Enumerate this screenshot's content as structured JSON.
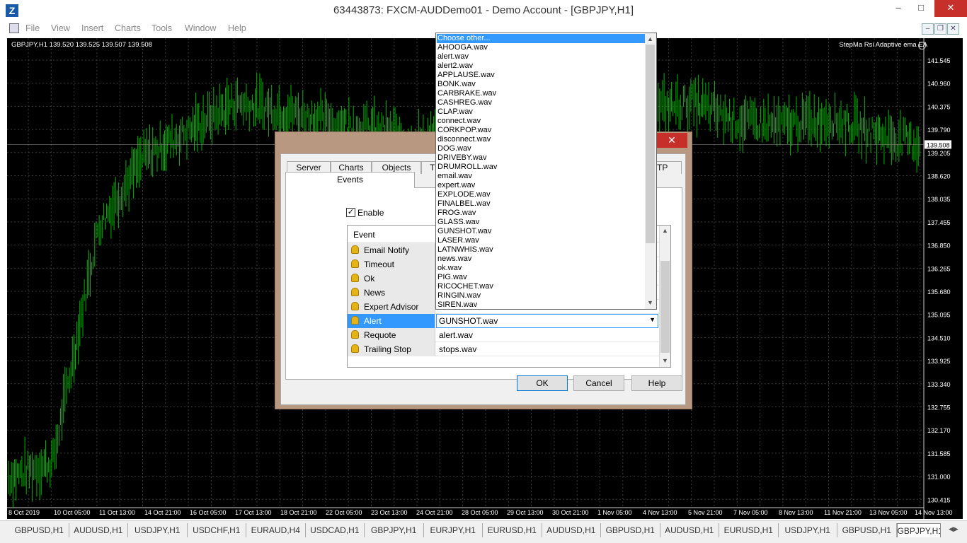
{
  "window": {
    "title": "63443873: FXCM-AUDDemo01 - Demo Account - [GBPJPY,H1]",
    "icon_label": "Z",
    "minimize": "–",
    "maximize": "□",
    "close": "✕"
  },
  "menu": {
    "items": [
      "File",
      "View",
      "Insert",
      "Charts",
      "Tools",
      "Window",
      "Help"
    ],
    "mdi_minimize": "–",
    "mdi_restore": "❐",
    "mdi_close": "✕"
  },
  "chart": {
    "symbol_info": "GBPJPY,H1  139.520 139.525 139.507 139.508",
    "ea_label": "StepMa Rsi Adaptive ema EA",
    "current_price": "139.508",
    "current_price_value": 139.508,
    "price_ticks": [
      "141.545",
      "140.960",
      "140.375",
      "139.790",
      "139.205",
      "138.620",
      "138.035",
      "137.455",
      "136.850",
      "136.265",
      "135.680",
      "135.095",
      "134.510",
      "133.925",
      "133.340",
      "132.755",
      "132.170",
      "131.585",
      "131.000",
      "130.415"
    ],
    "time_ticks": [
      "8 Oct 2019",
      "10 Oct 05:00",
      "11 Oct 13:00",
      "14 Oct 21:00",
      "16 Oct 05:00",
      "17 Oct 13:00",
      "18 Oct 21:00",
      "22 Oct 05:00",
      "23 Oct 13:00",
      "24 Oct 21:00",
      "28 Oct 05:00",
      "29 Oct 13:00",
      "30 Oct 21:00",
      "1 Nov 05:00",
      "4 Nov 13:00",
      "5 Nov 21:00",
      "7 Nov 05:00",
      "8 Nov 13:00",
      "11 Nov 21:00",
      "13 Nov 05:00",
      "14 Nov 13:00"
    ],
    "colors": {
      "background": "#000000",
      "grid": "#3c3c3c",
      "bars": "#00b400",
      "axis_text": "#ffffff"
    }
  },
  "chart_data": {
    "type": "line",
    "title": "GBPJPY,H1",
    "x": [
      "8 Oct 2019",
      "10 Oct 05:00",
      "11 Oct 13:00",
      "14 Oct 21:00",
      "16 Oct 05:00",
      "17 Oct 13:00",
      "18 Oct 21:00",
      "22 Oct 05:00",
      "23 Oct 13:00",
      "24 Oct 21:00",
      "28 Oct 05:00",
      "29 Oct 13:00",
      "30 Oct 21:00",
      "1 Nov 05:00",
      "4 Nov 13:00",
      "5 Nov 21:00",
      "7 Nov 05:00",
      "8 Nov 13:00",
      "11 Nov 21:00",
      "13 Nov 05:00",
      "14 Nov 13:00"
    ],
    "series": [
      {
        "values": [
          130.9,
          131.3,
          137.4,
          139.2,
          139.9,
          140.6,
          140.4,
          140.1,
          139.9,
          139.6,
          139.8,
          140.3,
          140.5,
          140.2,
          140.4,
          140.6,
          140.1,
          140.0,
          140.2,
          139.8,
          139.5
        ]
      }
    ],
    "ylim": [
      130.2,
      142.0
    ],
    "grid": true
  },
  "symbol_tabs": [
    "GBPUSD,H1",
    "AUDUSD,H1",
    "USDJPY,H1",
    "USDCHF,H1",
    "EURAUD,H4",
    "USDCAD,H1",
    "GBPJPY,H1",
    "EURJPY,H1",
    "EURUSD,H1",
    "AUDUSD,H1",
    "GBPUSD,H1",
    "AUDUSD,H1",
    "EURUSD,H1",
    "USDJPY,H1",
    "GBPUSD,H1",
    "GBPJPY,H1"
  ],
  "dialog": {
    "close": "✕",
    "tabs": [
      "Server",
      "Charts",
      "Objects",
      "T",
      "TP"
    ],
    "active_tab": "Events",
    "enable_checkbox": {
      "label": "Enable",
      "checked": true,
      "mark": "✓"
    },
    "list_header": "Event",
    "events": [
      {
        "name": "Email Notify",
        "sound": ""
      },
      {
        "name": "Timeout",
        "sound": ""
      },
      {
        "name": "Ok",
        "sound": ""
      },
      {
        "name": "News",
        "sound": ""
      },
      {
        "name": "Expert Advisor",
        "sound": ""
      },
      {
        "name": "Alert",
        "sound": "GUNSHOT.wav",
        "selected": true
      },
      {
        "name": "Requote",
        "sound": "alert.wav"
      },
      {
        "name": "Trailing Stop",
        "sound": "stops.wav"
      }
    ],
    "buttons": {
      "ok": "OK",
      "cancel": "Cancel",
      "help": "Help"
    }
  },
  "dropdown": {
    "highlighted": "Choose other...",
    "options": [
      "Choose other...",
      "AHOOGA.wav",
      "alert.wav",
      "alert2.wav",
      "APPLAUSE.wav",
      "BONK.wav",
      "CARBRAKE.wav",
      "CASHREG.wav",
      "CLAP.wav",
      "connect.wav",
      "CORKPOP.wav",
      "disconnect.wav",
      "DOG.wav",
      "DRIVEBY.wav",
      "DRUMROLL.wav",
      "email.wav",
      "expert.wav",
      "EXPLODE.wav",
      "FINALBEL.wav",
      "FROG.wav",
      "GLASS.wav",
      "GUNSHOT.wav",
      "LASER.wav",
      "LATNWHIS.wav",
      "news.wav",
      "ok.wav",
      "PIG.wav",
      "RICOCHET.wav",
      "RINGIN.wav",
      "SIREN.wav"
    ]
  }
}
